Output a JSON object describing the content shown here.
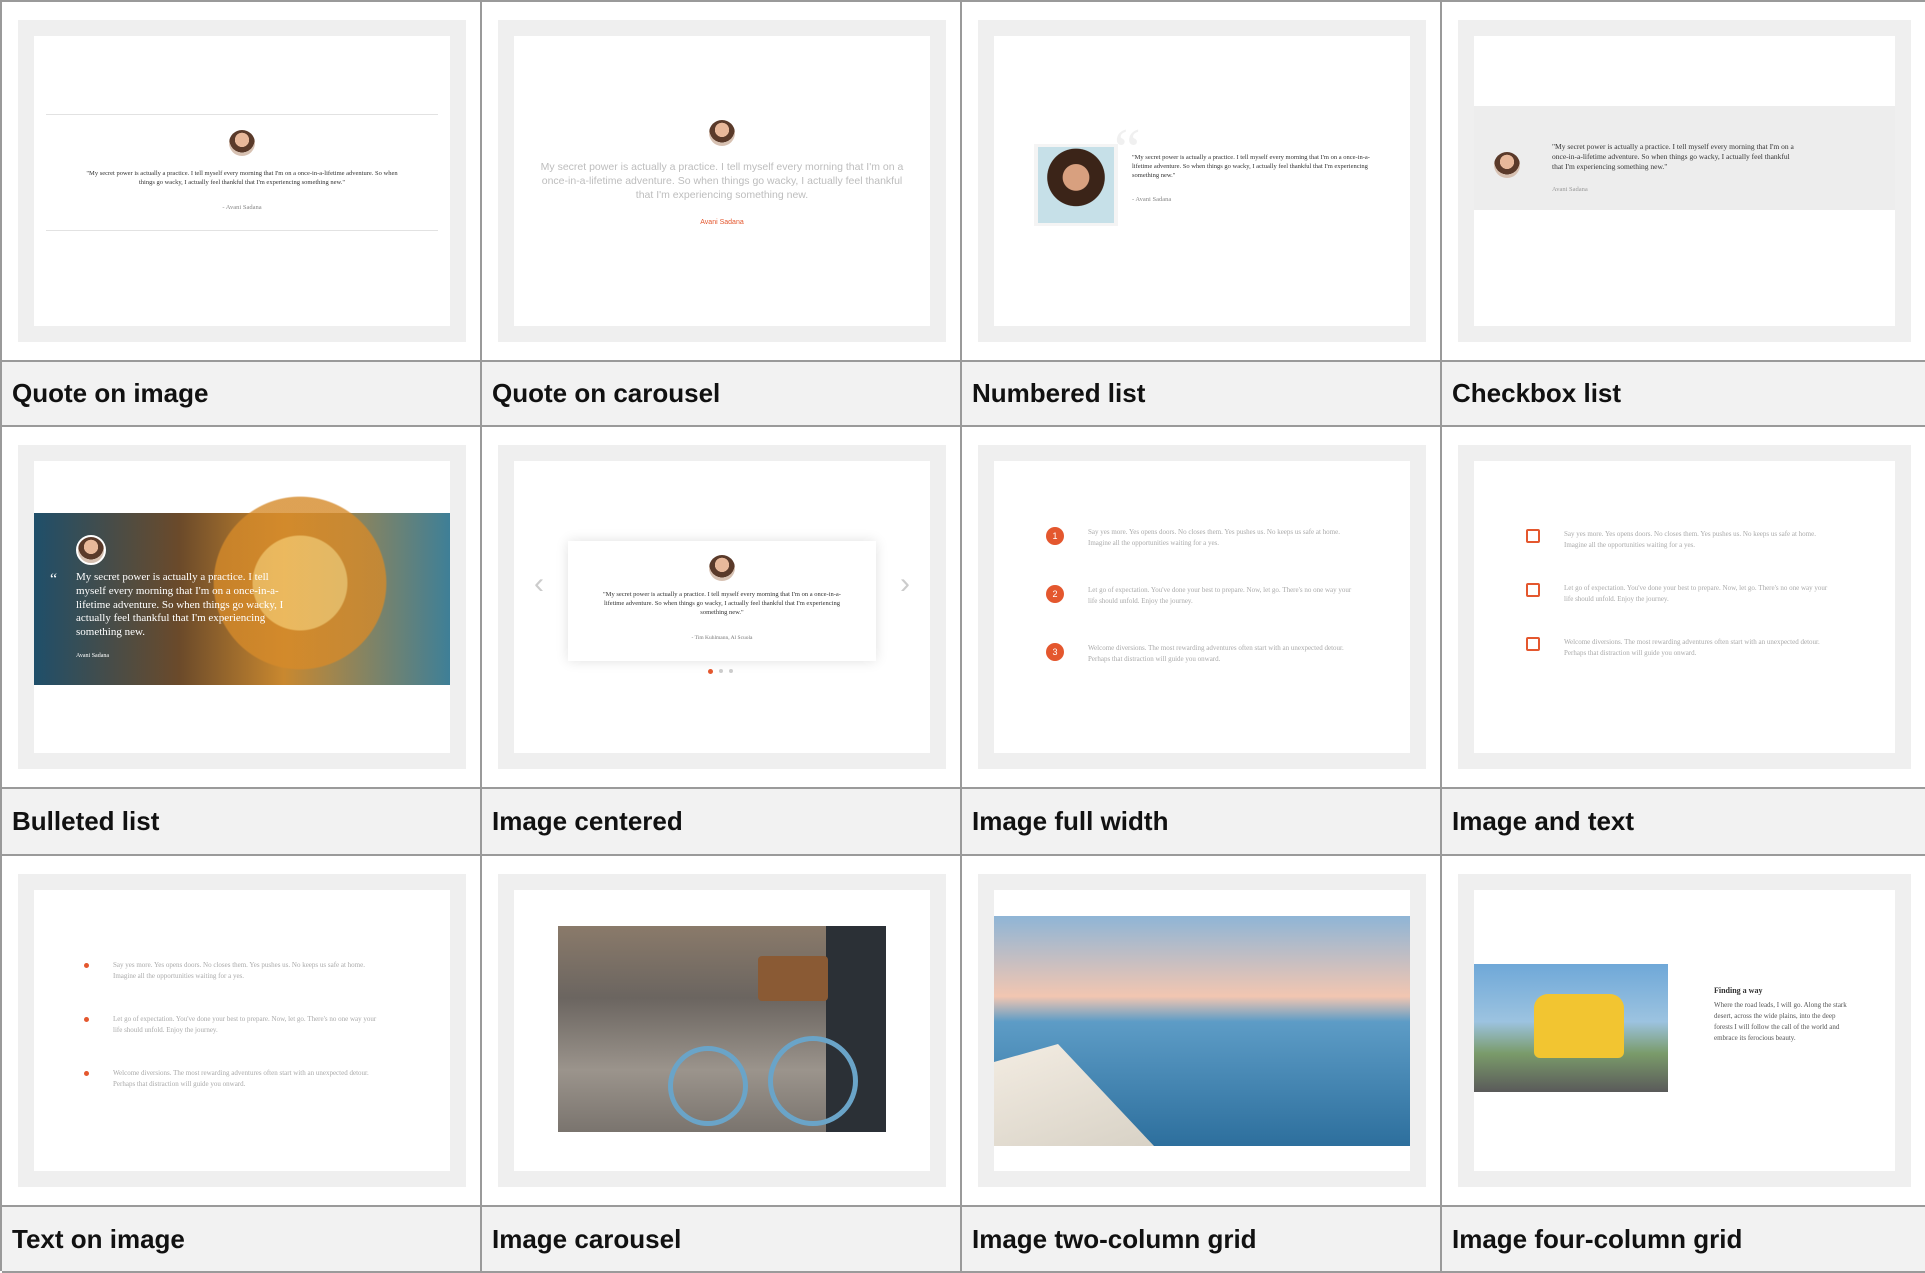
{
  "labels": {
    "r1": [
      "Quote on image",
      "Quote on carousel",
      "Numbered list",
      "Checkbox list"
    ],
    "r2": [
      "Bulleted list",
      "Image centered",
      "Image full width",
      "Image and text"
    ],
    "r3": [
      "Text on image",
      "Image carousel",
      "Image two-column grid",
      "Image four-column grid"
    ]
  },
  "quote": {
    "short": "\"My secret power is actually a practice. I tell myself every morning that I'm on a once-in-a-lifetime adventure. So when things go wacky, I actually feel thankful that I'm experiencing something new.\"",
    "plain": "My secret power is actually a practice. I tell myself every morning that I'm on a once-in-a-lifetime adventure. So when things go wacky, I actually feel thankful that I'm experiencing something new.",
    "author": "- Avani Sadana",
    "author_name": "Avani Sadana",
    "author_alt": "- Tim Kuhlmann, Al Scuola"
  },
  "list_items": [
    "Say yes more. Yes opens doors. No closes them. Yes pushes us. No keeps us safe at home. Imagine all the opportunities waiting for a yes.",
    "Let go of expectation. You've done your best to prepare. Now, let go. There's no one way your life should unfold. Enjoy the journey.",
    "Welcome diversions. The most rewarding adventures often start with an unexpected detour. Perhaps that distraction will guide you onward."
  ],
  "numbers": [
    "1",
    "2",
    "3"
  ],
  "quote_mark": "“",
  "carousel": {
    "prev": "‹",
    "next": "›"
  },
  "image_text": {
    "heading": "Finding a way",
    "body": "Where the road leads, I will go. Along the stark desert, across the wide plains, into the deep forests I will follow the call of the world and embrace its ferocious beauty."
  },
  "colors": {
    "accent": "#e4572e",
    "border": "#9a9a9a",
    "label_bg": "#f2f2f2"
  }
}
